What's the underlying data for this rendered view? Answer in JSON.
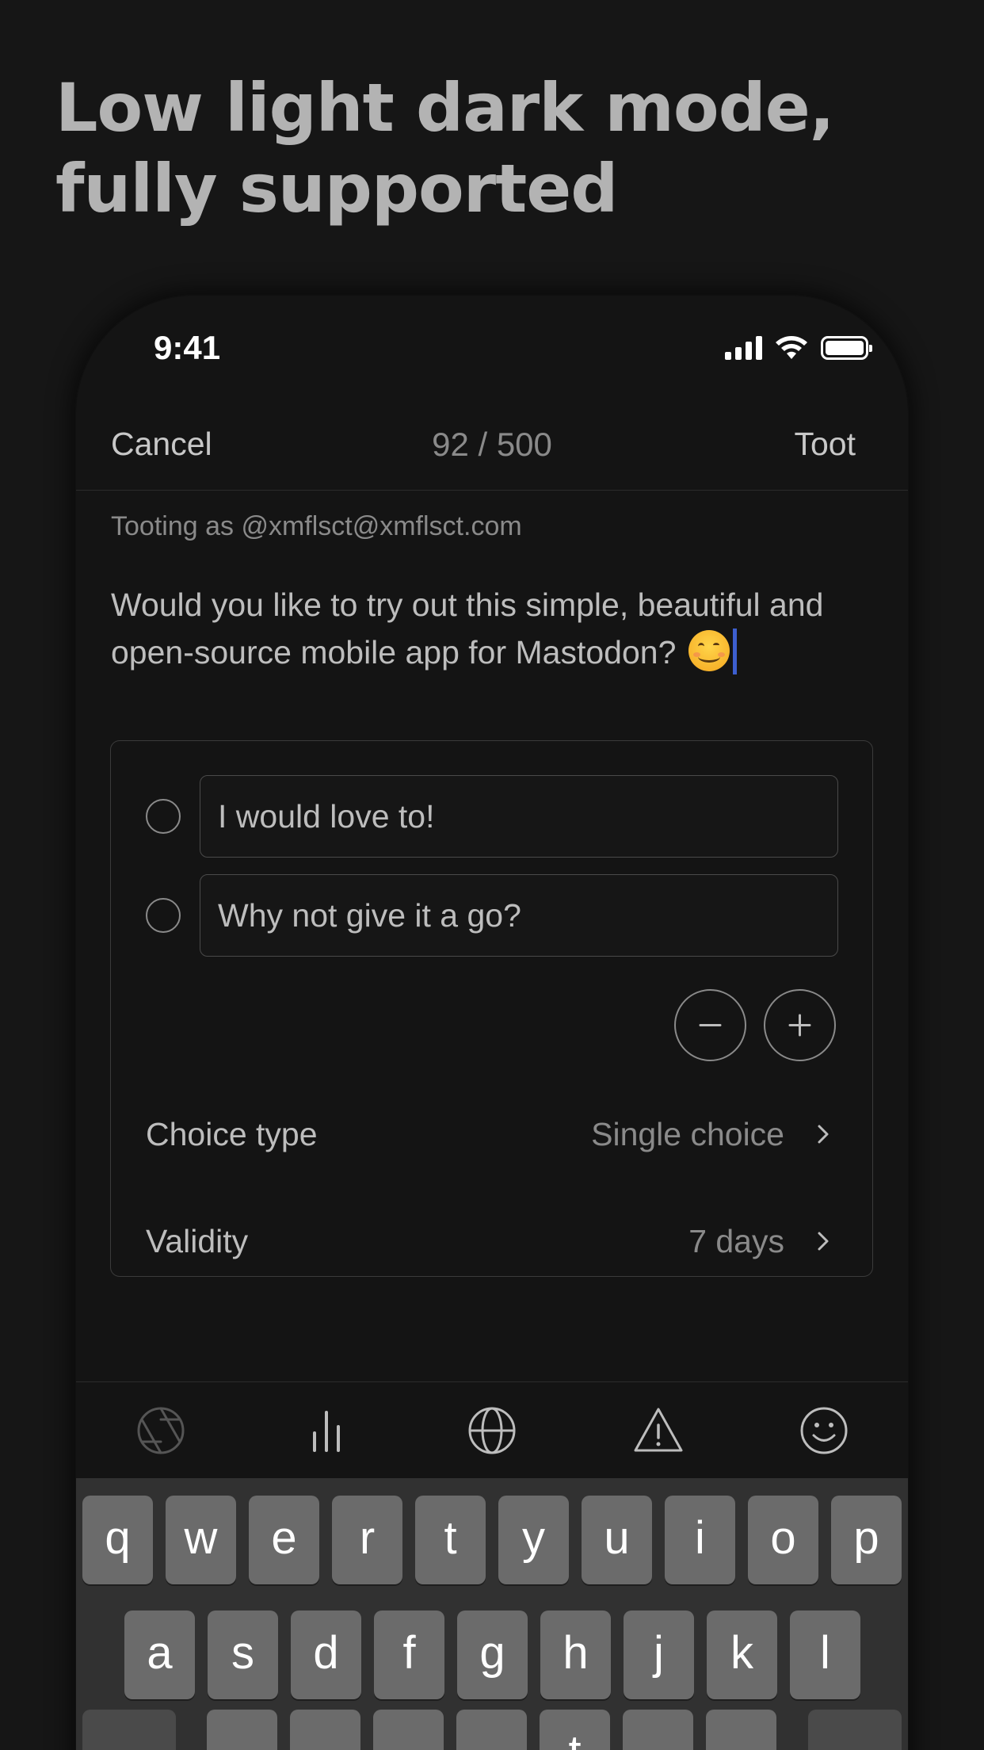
{
  "headline": {
    "line1": "Low light dark mode,",
    "line2": "fully supported"
  },
  "status_bar": {
    "time": "9:41",
    "icons": [
      "cellular-signal-icon",
      "wifi-icon",
      "battery-icon"
    ]
  },
  "nav": {
    "cancel_label": "Cancel",
    "char_counter": "92 / 500",
    "toot_label": "Toot"
  },
  "compose": {
    "tooting_as": "Tooting as @xmflsct@xmflsct.com",
    "text": "Would you like to try out this simple, beautiful and open-source mobile app for Mastodon?",
    "emoji": "smiling-face-emoji"
  },
  "poll": {
    "options": [
      {
        "text": "I would love to!"
      },
      {
        "text": "Why not give it a go?"
      }
    ],
    "remove_option_icon": "minus-icon",
    "add_option_icon": "plus-icon",
    "choice_type": {
      "label": "Choice type",
      "value": "Single choice"
    },
    "validity": {
      "label": "Validity",
      "value": "7 days"
    }
  },
  "toolbar": {
    "icons": [
      "camera-aperture-icon",
      "poll-icon",
      "globe-icon",
      "warning-icon",
      "emoji-icon"
    ]
  },
  "keyboard": {
    "row1": [
      "q",
      "w",
      "e",
      "r",
      "t",
      "y",
      "u",
      "i",
      "o",
      "p"
    ],
    "row2": [
      "a",
      "s",
      "d",
      "f",
      "g",
      "h",
      "j",
      "k",
      "l"
    ],
    "row3_visible": [
      "t"
    ]
  },
  "colors": {
    "background": "#161616",
    "phone_background": "#141414",
    "caret": "#3d5fcf",
    "key": "#6b6b6b",
    "keyboard": "#313131"
  }
}
